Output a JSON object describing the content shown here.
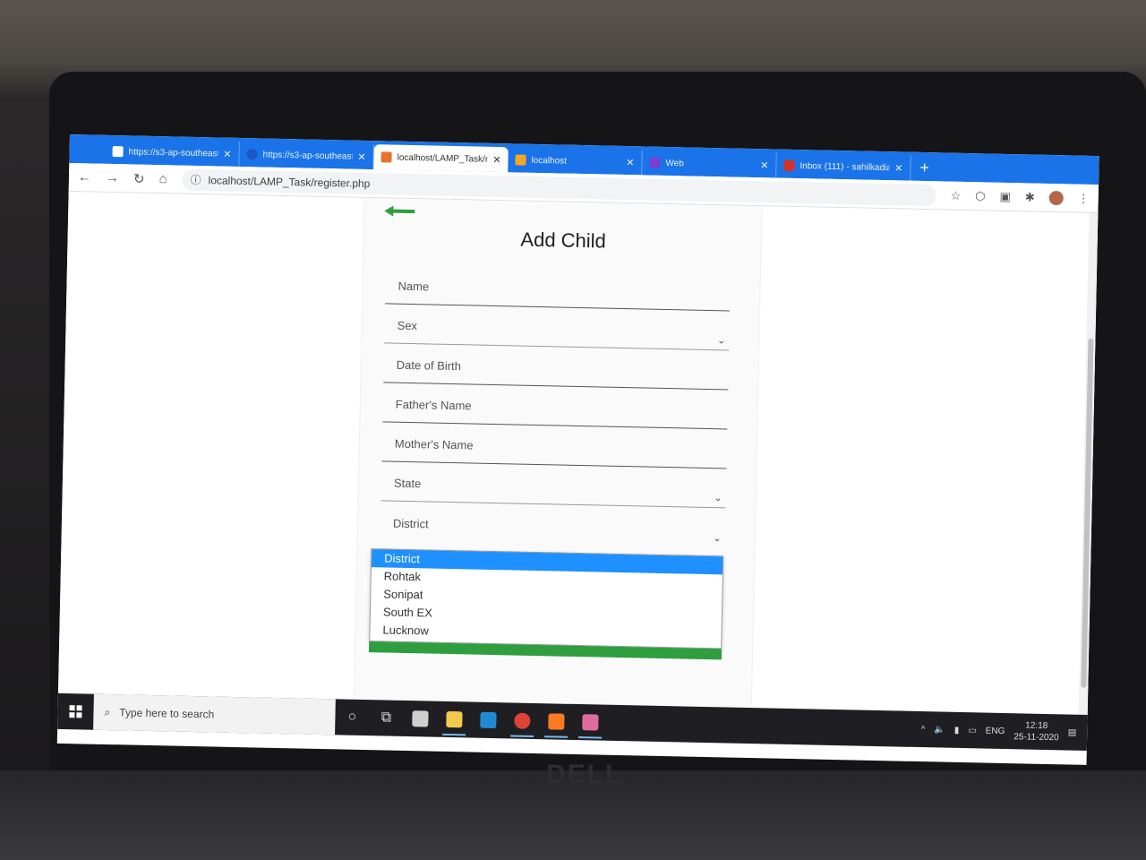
{
  "browser": {
    "tabs": [
      {
        "title": "https://s3-ap-southeast",
        "color": "#ffffff"
      },
      {
        "title": "https://s3-ap-southeast",
        "color": "#1a56c4"
      },
      {
        "title": "localhost/LAMP_Task/re",
        "color": "#e8732c",
        "active": true
      },
      {
        "title": "localhost",
        "color": "#f5a623"
      },
      {
        "title": "Web",
        "color": "#7a3fd1"
      },
      {
        "title": "Inbox (111) - sahilkadia",
        "color": "#d93025"
      }
    ],
    "url": "localhost/LAMP_Task/register.php"
  },
  "form": {
    "title": "Add Child",
    "fields": {
      "name": "Name",
      "sex": "Sex",
      "dob": "Date of Birth",
      "father": "Father's Name",
      "mother": "Mother's Name",
      "state": "State",
      "district": "District"
    },
    "district_options": [
      "District",
      "Rohtak",
      "Sonipat",
      "South EX",
      "Lucknow"
    ],
    "selected_option": "District"
  },
  "taskbar": {
    "search_placeholder": "Type here to search",
    "language": "ENG",
    "time": "12:18",
    "date": "25-11-2020"
  },
  "colors": {
    "tabbar": "#1a73e8",
    "submit": "#2e9e3e",
    "back_arrow": "#2e9e3e",
    "selected_option": "#1e90ff"
  }
}
